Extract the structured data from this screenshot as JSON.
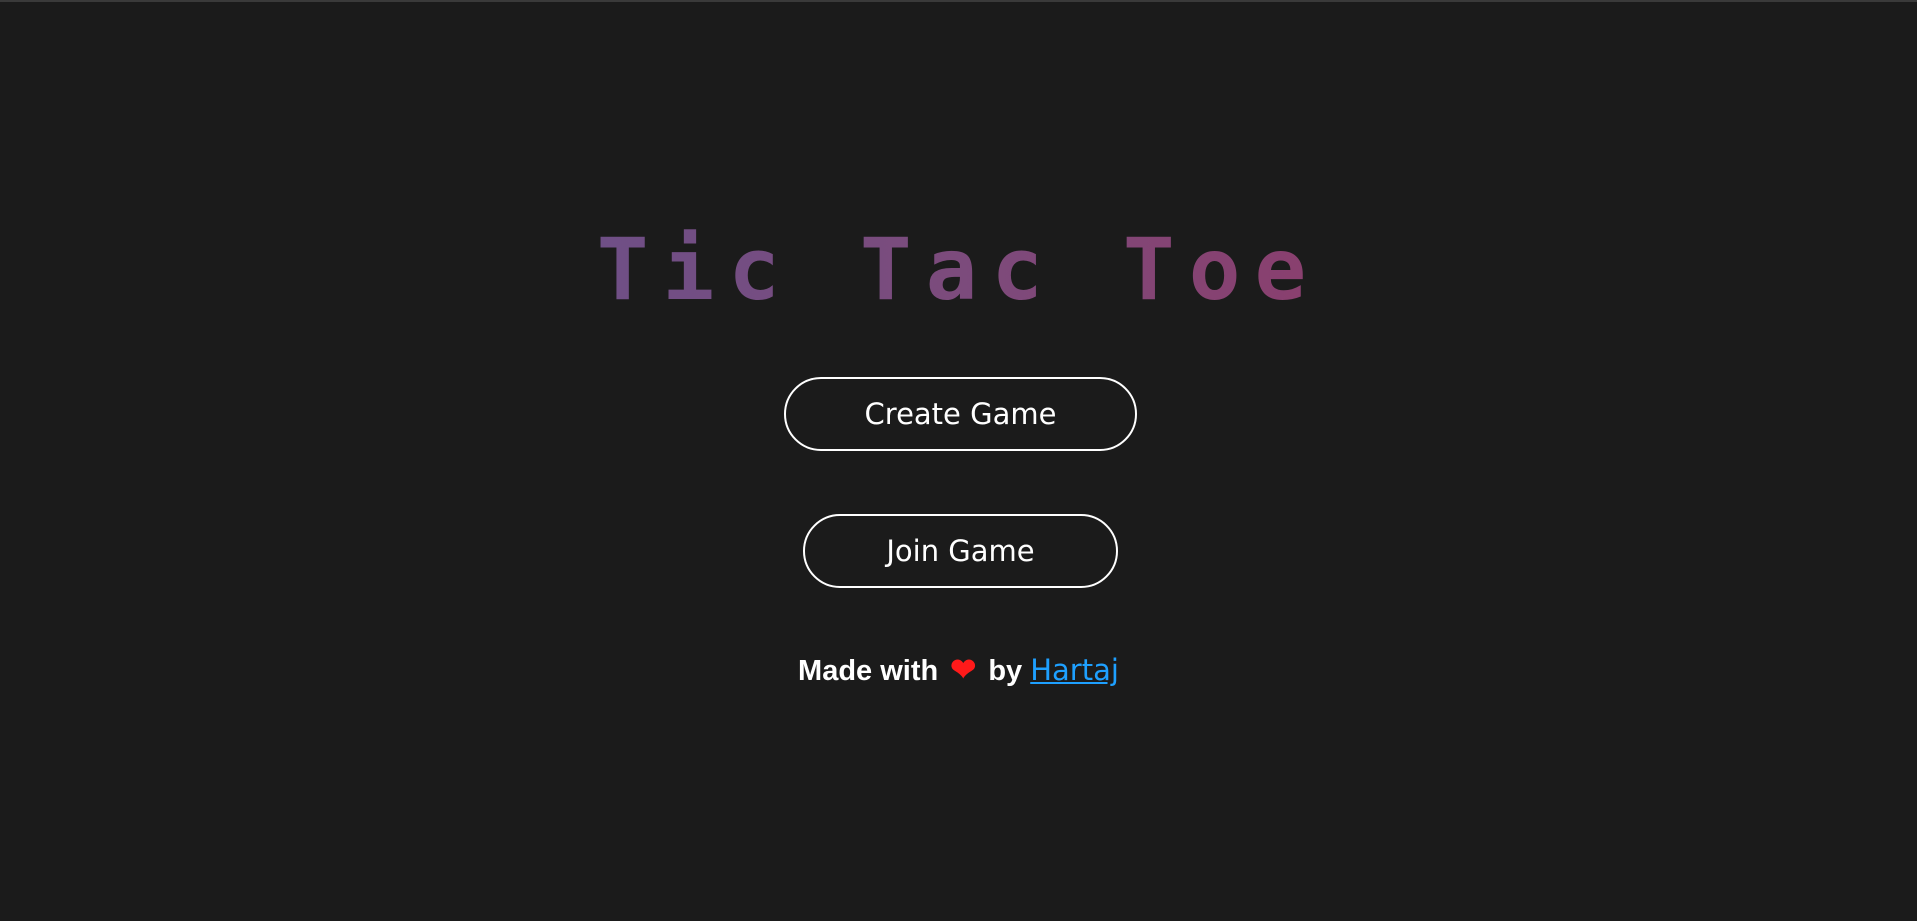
{
  "title": "Tic Tac Toe",
  "buttons": {
    "create": "Create Game",
    "join": "Join Game"
  },
  "footer": {
    "prefix": "Made with",
    "heart_icon": "heart-icon",
    "by": "by",
    "author": "Hartaj"
  },
  "colors": {
    "background": "#1b1b1b",
    "title_gradient_start": "#6f4f86",
    "title_gradient_end": "#8a3f6e",
    "heart": "#ff1a1a",
    "link": "#1ea0ff"
  }
}
